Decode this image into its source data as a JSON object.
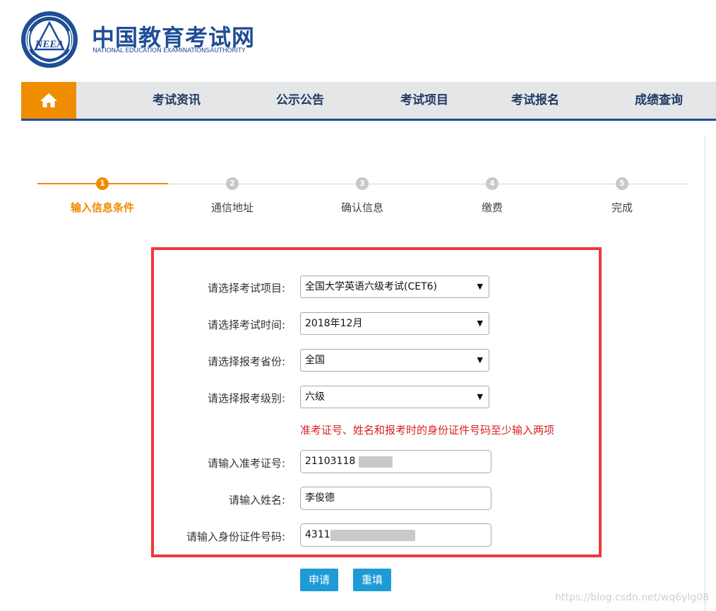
{
  "logo": {
    "title_cn": "中国教育考试网",
    "title_en": "NATIONAL EDUCATION EXAMINATIONSAUTHORITY",
    "emblem_text": "NEEA",
    "icon": "neea-emblem-icon"
  },
  "nav": {
    "home_icon": "home-icon",
    "items": [
      {
        "label": "考试资讯"
      },
      {
        "label": "公示公告"
      },
      {
        "label": "考试项目"
      },
      {
        "label": "考试报名"
      },
      {
        "label": "成绩查询"
      }
    ]
  },
  "steps": [
    {
      "num": "1",
      "label": "输入信息条件",
      "active": true
    },
    {
      "num": "2",
      "label": "通信地址",
      "active": false
    },
    {
      "num": "3",
      "label": "确认信息",
      "active": false
    },
    {
      "num": "4",
      "label": "缴费",
      "active": false
    },
    {
      "num": "5",
      "label": "完成",
      "active": false
    }
  ],
  "form": {
    "exam_item": {
      "label": "请选择考试项目:",
      "value": "全国大学英语六级考试(CET6)"
    },
    "exam_time": {
      "label": "请选择考试时间:",
      "value": "2018年12月"
    },
    "province": {
      "label": "请选择报考省份:",
      "value": "全国"
    },
    "level": {
      "label": "请选择报考级别:",
      "value": "六级"
    },
    "hint": "准考证号、姓名和报考时的身份证件号码至少输入两项",
    "ticket_no": {
      "label": "请输入准考证号:",
      "value": "21103118"
    },
    "name": {
      "label": "请输入姓名:",
      "value": "李俊德"
    },
    "id_no": {
      "label": "请输入身份证件号码:",
      "value": "4311"
    }
  },
  "buttons": {
    "apply": "申请",
    "reset": "重填"
  },
  "watermark": "https://blog.csdn.net/wq6ylg08",
  "colors": {
    "brand_blue": "#1f4d96",
    "accent_orange": "#f08c00",
    "highlight_red": "#ee3a3a",
    "button_blue": "#1e9ad6"
  }
}
